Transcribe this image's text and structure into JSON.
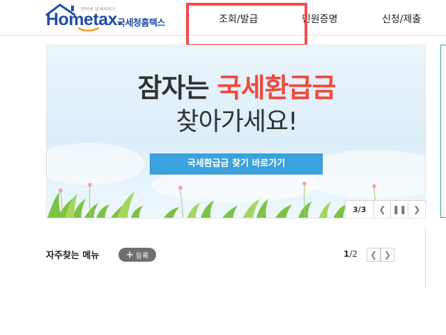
{
  "header": {
    "logo": {
      "tagline": "인터넷 납세서비스",
      "brand": "Hometax.",
      "subtitle": "국세청홈택스"
    },
    "nav": [
      {
        "label": "조회/발급"
      },
      {
        "label": "민원증명"
      },
      {
        "label": "신청/제출"
      }
    ],
    "highlight_color": "#f44b4b"
  },
  "banner": {
    "line1_pre": "잠자는 ",
    "line1_accent": "국세환급금",
    "line2": "찾아가세요!",
    "cta_label": "국세환급금 찾기 바로가기",
    "slider": {
      "current": "3",
      "total": "3",
      "prev_icon": "chevron-left-icon",
      "pause_icon": "pause-icon",
      "next_icon": "chevron-right-icon"
    },
    "accent_color": "#f04a3c",
    "cta_color": "#3aa2dc"
  },
  "frequent_menu": {
    "title": "자주찾는 메뉴",
    "register_label": "등록",
    "page_current": "1",
    "page_total": "2"
  }
}
